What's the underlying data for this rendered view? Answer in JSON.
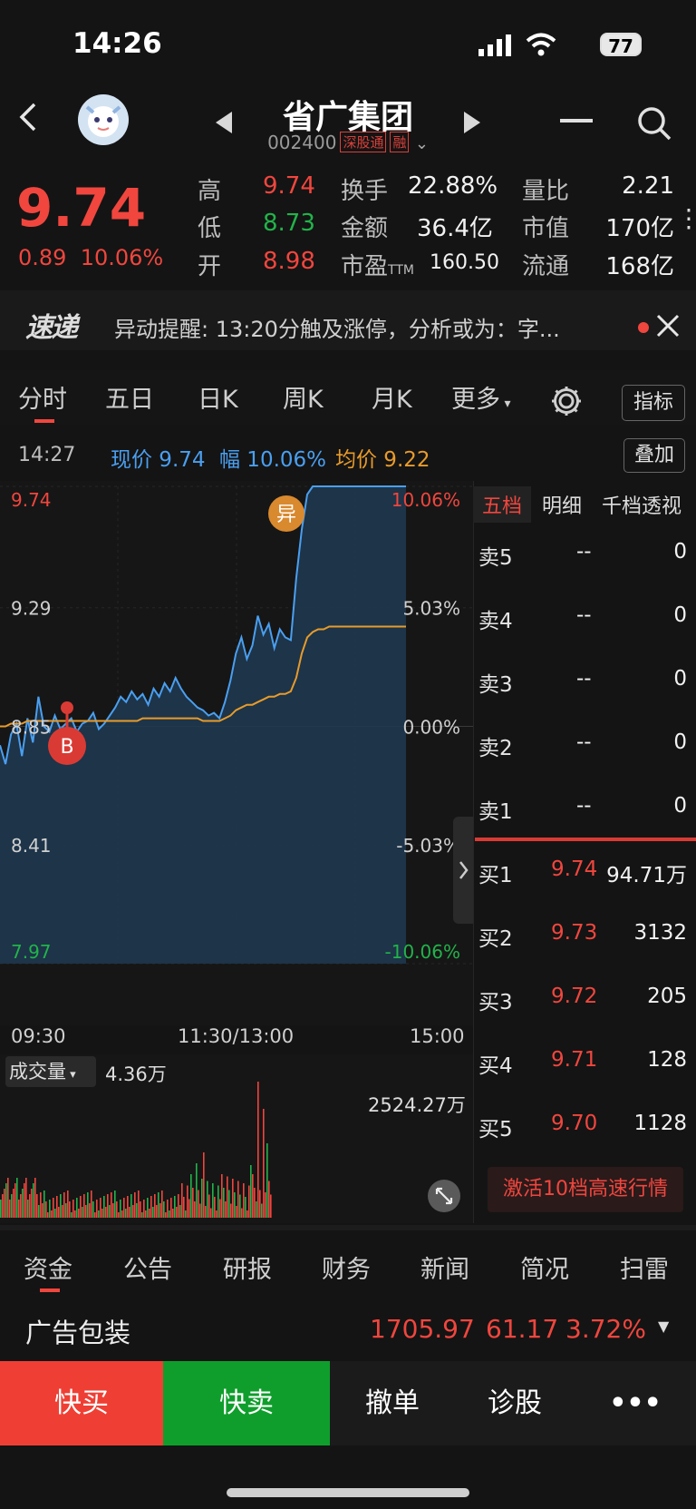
{
  "status_bar": {
    "time": "14:26",
    "battery": "77"
  },
  "header": {
    "name": "省广集团",
    "code": "002400",
    "tags": [
      "深股通",
      "融"
    ]
  },
  "quote": {
    "price": "9.74",
    "change": "0.89",
    "change_pct": "10.06%",
    "rows": [
      {
        "l1": "高",
        "v1": "9.74",
        "l2": "换手",
        "v2": "22.88%",
        "l3": "量比",
        "v3": "2.21"
      },
      {
        "l1": "低",
        "v1": "8.73",
        "l2": "金额",
        "v2": "36.4亿",
        "l3": "市值",
        "v3": "170亿"
      },
      {
        "l1": "开",
        "v1": "8.98",
        "l2": "市盈",
        "l2_sub": "TTM",
        "v2": "160.50",
        "l3": "流通",
        "v3": "168亿"
      }
    ]
  },
  "news": {
    "logo": "速递",
    "text": "异动提醒: 13:20分触及涨停，分析或为：字..."
  },
  "tabs": {
    "items": [
      "分时",
      "五日",
      "日K",
      "周K",
      "月K",
      "更多"
    ],
    "indicator_btn": "指标",
    "overlay_btn": "叠加"
  },
  "info_row": {
    "time": "14:27",
    "price_label": "现价 9.74",
    "pct_label": "幅 10.06%",
    "avg_label": "均价 9.22"
  },
  "chart_data": {
    "type": "line",
    "title": "",
    "xlabel": "",
    "ylabel": "",
    "ylim": [
      7.97,
      9.74
    ],
    "x_ticks": [
      "09:30",
      "11:30/13:00",
      "15:00"
    ],
    "y_left_ticks": [
      "9.74",
      "9.29",
      "8.85",
      "8.41",
      "7.97"
    ],
    "y_right_ticks": [
      "10.06%",
      "5.03%",
      "0.00%",
      "-5.03%",
      "-10.06%"
    ],
    "series": [
      {
        "values": [
          8.78,
          8.71,
          8.82,
          8.86,
          8.74,
          8.88,
          8.79,
          8.96,
          8.85,
          8.83,
          8.89,
          8.84,
          8.86,
          8.88,
          8.83,
          8.86,
          8.87,
          8.9,
          8.84,
          8.86,
          8.89,
          8.92,
          8.96,
          8.94,
          8.98,
          8.95,
          8.97,
          8.93,
          8.99,
          8.96,
          9.01,
          8.98,
          9.03,
          8.99,
          8.96,
          8.94,
          8.92,
          8.91,
          8.89,
          8.9,
          8.88,
          8.94,
          9.02,
          9.12,
          9.18,
          9.1,
          9.15,
          9.26,
          9.19,
          9.23,
          9.14,
          9.21,
          9.18,
          9.17,
          9.4,
          9.58,
          9.71,
          9.74,
          9.74,
          9.74,
          9.74,
          9.74,
          9.74,
          9.74,
          9.74,
          9.74,
          9.74,
          9.74,
          9.74,
          9.74,
          9.74,
          9.74,
          9.74,
          9.74,
          9.74
        ]
      },
      {
        "values": [
          8.85,
          8.85,
          8.86,
          8.86,
          8.86,
          8.87,
          8.87,
          8.87,
          8.87,
          8.87,
          8.87,
          8.87,
          8.87,
          8.87,
          8.87,
          8.87,
          8.87,
          8.87,
          8.87,
          8.87,
          8.87,
          8.87,
          8.87,
          8.87,
          8.87,
          8.87,
          8.88,
          8.88,
          8.88,
          8.88,
          8.88,
          8.88,
          8.88,
          8.88,
          8.88,
          8.88,
          8.88,
          8.87,
          8.87,
          8.87,
          8.87,
          8.88,
          8.89,
          8.91,
          8.92,
          8.93,
          8.93,
          8.94,
          8.95,
          8.96,
          8.96,
          8.97,
          8.97,
          8.98,
          9.03,
          9.12,
          9.18,
          9.2,
          9.21,
          9.21,
          9.22,
          9.22,
          9.22,
          9.22,
          9.22,
          9.22,
          9.22,
          9.22,
          9.22,
          9.22,
          9.22,
          9.22,
          9.22,
          9.22,
          9.22
        ]
      }
    ],
    "markers": [
      {
        "label": "异"
      },
      {
        "label": "B"
      }
    ]
  },
  "order_book": {
    "tabs": [
      "五档",
      "明细",
      "千档透视"
    ],
    "sells": [
      {
        "label": "卖5",
        "price": "--",
        "vol": "0"
      },
      {
        "label": "卖4",
        "price": "--",
        "vol": "0"
      },
      {
        "label": "卖3",
        "price": "--",
        "vol": "0"
      },
      {
        "label": "卖2",
        "price": "--",
        "vol": "0"
      },
      {
        "label": "卖1",
        "price": "--",
        "vol": "0"
      }
    ],
    "buys": [
      {
        "label": "买1",
        "price": "9.74",
        "vol": "94.71万"
      },
      {
        "label": "买2",
        "price": "9.73",
        "vol": "3132"
      },
      {
        "label": "买3",
        "price": "9.72",
        "vol": "205"
      },
      {
        "label": "买4",
        "price": "9.71",
        "vol": "128"
      },
      {
        "label": "买5",
        "price": "9.70",
        "vol": "1128"
      }
    ],
    "activate_btn": "激活10档高速行情"
  },
  "volume": {
    "dropdown": "成交量",
    "current": "4.36万",
    "max": "2524.27万"
  },
  "bottom_tabs": [
    "资金",
    "公告",
    "研报",
    "财务",
    "新闻",
    "简况",
    "扫雷"
  ],
  "sector": {
    "name": "广告包装",
    "index": "1705.97",
    "change": "61.17",
    "change_pct": "3.72%"
  },
  "actions": {
    "buy": "快买",
    "sell": "快卖",
    "cancel": "撤单",
    "diagnose": "诊股",
    "more": "•••"
  },
  "colors": {
    "up": "#f0463e",
    "down": "#22b34a",
    "price_line": "#4a9ff0",
    "avg_line": "#e89b2a",
    "buy_btn": "#ef3f34",
    "sell_btn": "#0f9e2c"
  }
}
